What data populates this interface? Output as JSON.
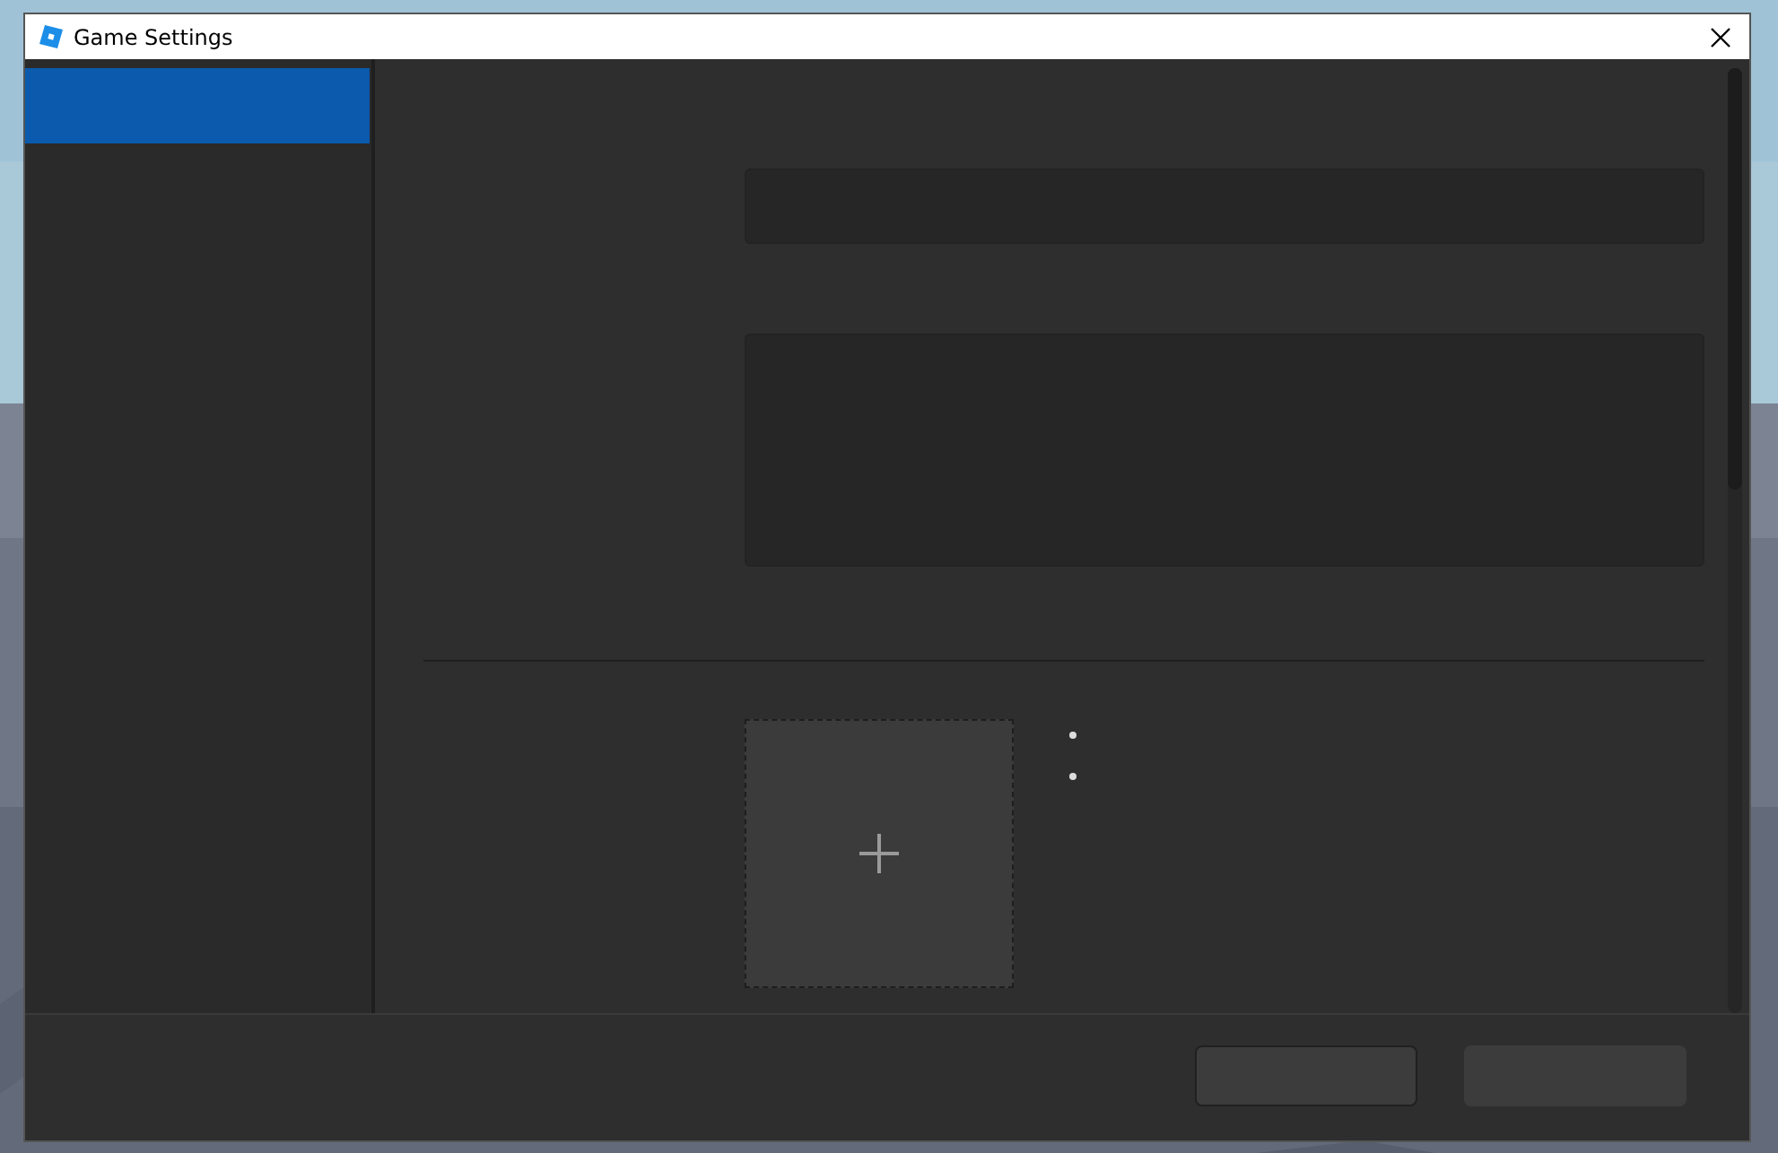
{
  "window": {
    "title": "Game Settings"
  },
  "sidebar": {
    "items": [
      {
        "selected": true
      }
    ]
  },
  "footer": {
    "buttons": [
      {
        "kind": "outlined"
      },
      {
        "kind": "filled"
      }
    ]
  }
}
